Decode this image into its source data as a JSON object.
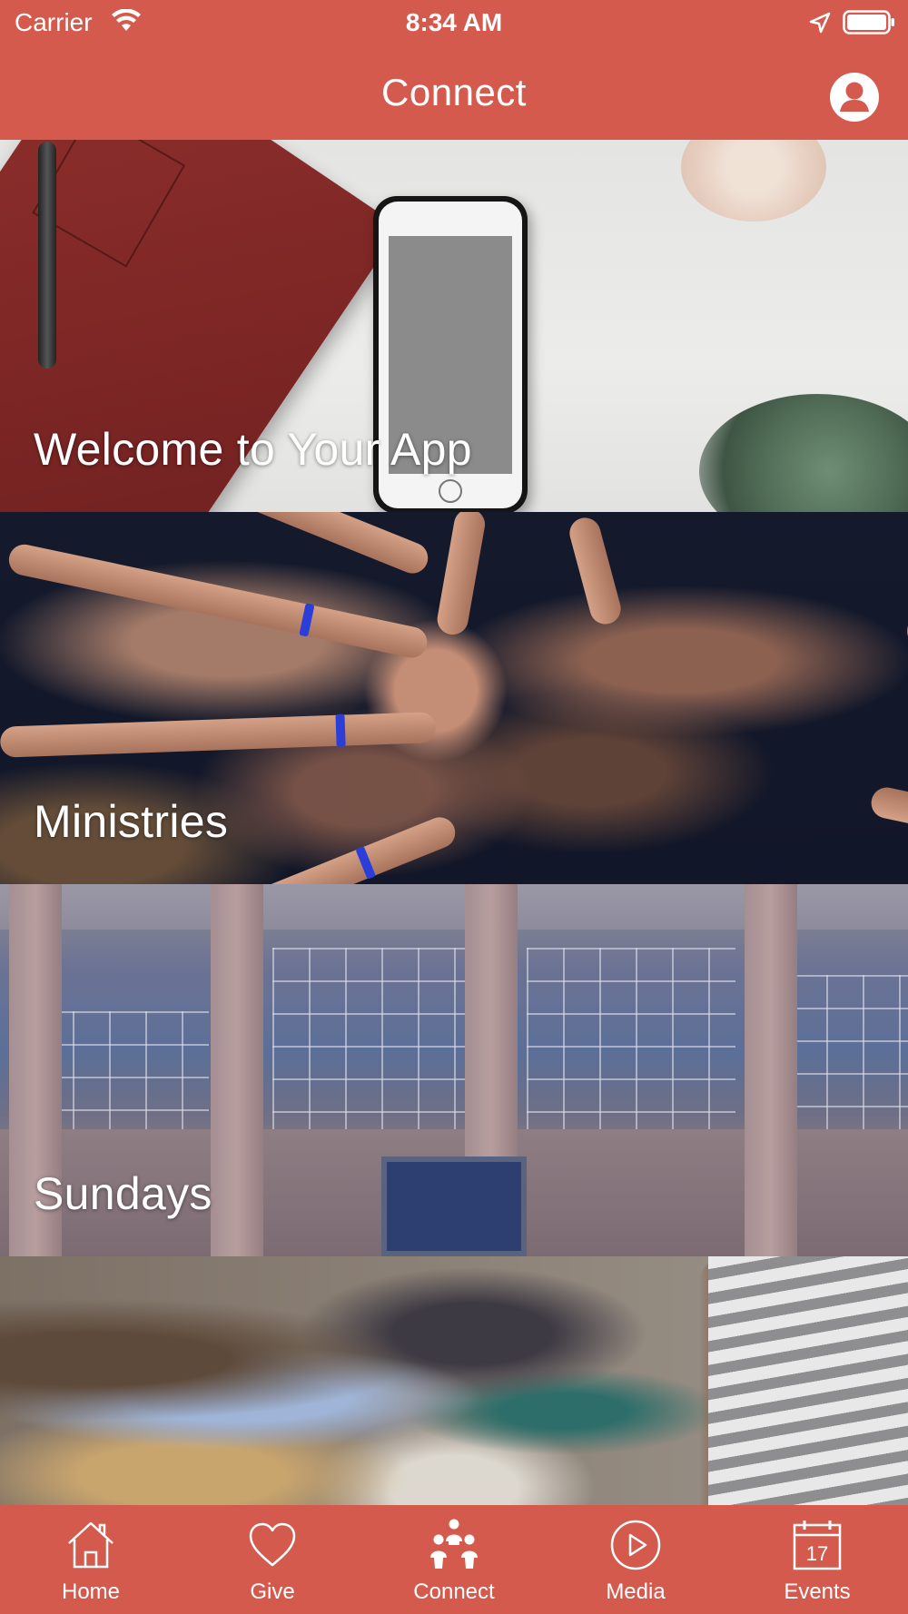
{
  "status_bar": {
    "carrier": "Carrier",
    "time": "8:34 AM",
    "icons": [
      "wifi-icon",
      "location-arrow-icon",
      "battery-icon"
    ]
  },
  "nav": {
    "title": "Connect",
    "profile_icon": "user-profile-icon"
  },
  "tiles": [
    {
      "label": "Welcome to Your App",
      "image": "desk-with-phone-photo"
    },
    {
      "label": "Ministries",
      "image": "stacked-hands-photo"
    },
    {
      "label": "Sundays",
      "image": "church-building-photo"
    },
    {
      "label": "",
      "image": "group-bible-study-photo"
    }
  ],
  "tabbar": {
    "items": [
      {
        "label": "Home",
        "icon": "home-icon"
      },
      {
        "label": "Give",
        "icon": "heart-icon"
      },
      {
        "label": "Connect",
        "icon": "people-icon",
        "selected": true
      },
      {
        "label": "Media",
        "icon": "play-icon"
      },
      {
        "label": "Events",
        "icon": "calendar-icon",
        "calendar_day": "17"
      }
    ]
  },
  "colors": {
    "brand": "#d45a4d",
    "text": "#ffffff"
  }
}
